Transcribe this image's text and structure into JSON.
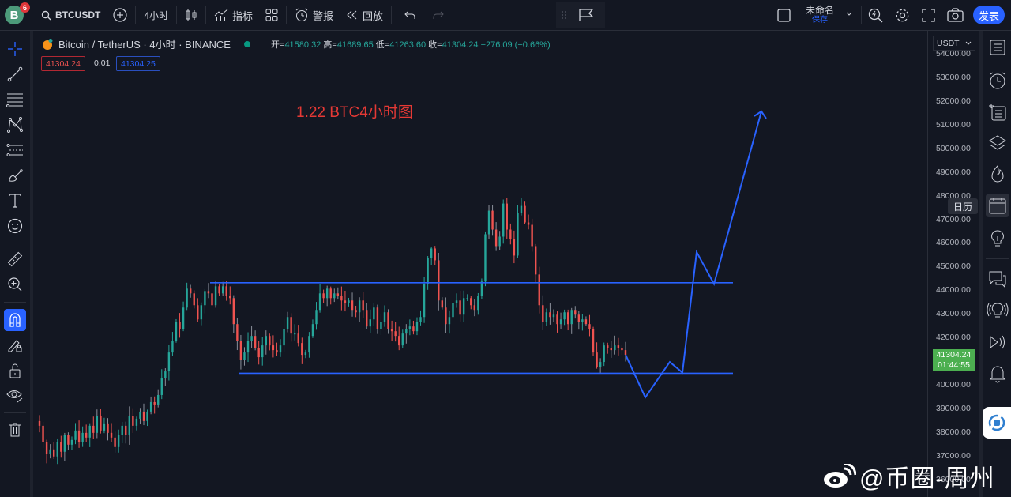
{
  "topbar": {
    "avatar_letter": "B",
    "notification_count": "6",
    "symbol": "BTCUSDT",
    "interval": "4小时",
    "indicators_label": "指标",
    "alert_label": "警报",
    "replay_label": "回放",
    "layout_name": "未命名",
    "save_label": "保存",
    "publish_label": "发表"
  },
  "legend": {
    "title": "Bitcoin / TetherUS · 4小时 · BINANCE",
    "open_label": "开=",
    "open": "41580.32",
    "high_label": "高=",
    "high": "41689.65",
    "low_label": "低=",
    "low": "41263.60",
    "close_label": "收=",
    "close": "41304.24",
    "change": "−276.09 (−0.66%)",
    "bid": "41304.24",
    "spread": "0.01",
    "ask": "41304.25"
  },
  "annotation": "1.22 BTC4小时图",
  "price_axis": {
    "currency": "USDT",
    "current_price": "41304.24",
    "countdown": "01:44:55",
    "calendar_tooltip": "日历"
  },
  "watermark": "@币圈-周州",
  "colors": {
    "up": "#26a69a",
    "down": "#ef5350",
    "line": "#2962ff",
    "annotation": "#e53935",
    "current_price_bg": "#4caf50"
  },
  "chart_data": {
    "type": "candlestick",
    "symbol": "BTCUSDT",
    "interval": "4h",
    "ylim": [
      35800,
      54300
    ],
    "y_ticks": [
      54000,
      53000,
      52000,
      51000,
      50000,
      49000,
      48000,
      47000,
      46000,
      45000,
      44000,
      43000,
      42000,
      41000,
      40000,
      39000,
      38000,
      37000,
      36000
    ],
    "price_path": [
      38300,
      37600,
      37100,
      37300,
      37000,
      37600,
      37200,
      37900,
      37500,
      37700,
      38100,
      37600,
      38000,
      37800,
      38300,
      38000,
      38700,
      38100,
      38400,
      38000,
      37800,
      37400,
      37900,
      38300,
      37900,
      38700,
      38300,
      38600,
      38900,
      38500,
      38900,
      39300,
      39200,
      39600,
      40300,
      40600,
      41400,
      41900,
      42700,
      42400,
      43300,
      44100,
      43900,
      43400,
      42800,
      43400,
      44000,
      43900,
      43400,
      44200,
      43900,
      44200,
      43800,
      43700,
      42600,
      41900,
      41100,
      41400,
      41900,
      42100,
      41600,
      41200,
      41700,
      42100,
      41700,
      41500,
      41400,
      41700,
      42400,
      42900,
      42200,
      42200,
      41800,
      41300,
      41400,
      42100,
      42600,
      43200,
      43900,
      43700,
      44100,
      43700,
      43900,
      43800,
      43600,
      43500,
      43600,
      43200,
      43100,
      43600,
      43200,
      42500,
      42800,
      43300,
      42400,
      42700,
      43100,
      42400,
      42300,
      42100,
      41700,
      42200,
      42400,
      42500,
      42300,
      42700,
      42900,
      44300,
      45400,
      45800,
      45300,
      43600,
      43300,
      42600,
      42900,
      43500,
      43600,
      43000,
      43700,
      43700,
      43400,
      43200,
      43800,
      44400,
      46400,
      47400,
      46600,
      45900,
      46300,
      47700,
      46600,
      46200,
      45500,
      47300,
      47600,
      46900,
      46800,
      45900,
      44700,
      43400,
      42700,
      43100,
      42900,
      43000,
      42600,
      42800,
      43100,
      42600,
      43200,
      43000,
      42700,
      42800,
      42600,
      42400,
      41400,
      40800,
      41000,
      41700,
      41600,
      41500,
      41700,
      41600,
      41500,
      41304
    ],
    "range_lines": [
      {
        "name": "resistance",
        "price": 44350
      },
      {
        "name": "support",
        "price": 40520
      }
    ],
    "projection_path": [
      41304,
      39500,
      41000,
      40550,
      45650,
      44300,
      51600
    ],
    "projection_arrow": true,
    "title": "1.22 BTC4小时图"
  }
}
